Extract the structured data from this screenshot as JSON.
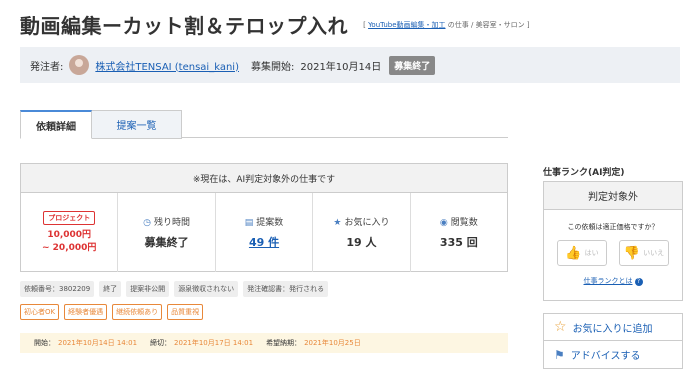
{
  "title": "動画編集ーカット割＆テロップ入れ",
  "breadcrumb": {
    "open": "[",
    "link": "YouTube動画編集・加工",
    "rest": "の仕事 / 美容室・サロン",
    "close": "]"
  },
  "client": {
    "label": "発注者:",
    "name": "株式会社TENSAI (tensai_kani)",
    "start_label": "募集開始:",
    "start_date": "2021年10月14日",
    "status": "募集終了"
  },
  "tabs": [
    "依頼詳細",
    "提案一覧"
  ],
  "notice": "※現在は、AI判定対象外の仕事です",
  "project": {
    "badge": "プロジェクト",
    "price_min": "10,000円",
    "price_max": "~ 20,000円"
  },
  "stats": [
    {
      "label": "残り時間",
      "value": "募集終了"
    },
    {
      "label": "提案数",
      "value": "49 件"
    },
    {
      "label": "お気に入り",
      "value": "19 人"
    },
    {
      "label": "閲覧数",
      "value": "335 回"
    }
  ],
  "tags": [
    "依頼番号：3802209",
    "終了",
    "提案非公開",
    "源泉徴収されない",
    "発注確認書：発行される"
  ],
  "tags2": [
    "初心者OK",
    "経験者優遇",
    "継続依頼あり",
    "品質重視"
  ],
  "dates": {
    "start_label": "開始：",
    "start": "2021年10月14日 14:01",
    "end_label": "締切：",
    "end": "2021年10月17日 14:01",
    "due_label": "希望納期：",
    "due": "2021年10月25日"
  },
  "side": {
    "rank_title": "仕事ランク(AI判定)",
    "rank_head": "判定対象外",
    "question": "この依頼は適正価格ですか？",
    "yes": "はい",
    "no": "いいえ",
    "rank_link": "仕事ランクとは",
    "fav": "お気に入りに追加",
    "advice": "アドバイスする"
  },
  "colors": {
    "accent": "#1a5fb4",
    "price": "#dd3333",
    "tag_orange": "#e8883a"
  }
}
